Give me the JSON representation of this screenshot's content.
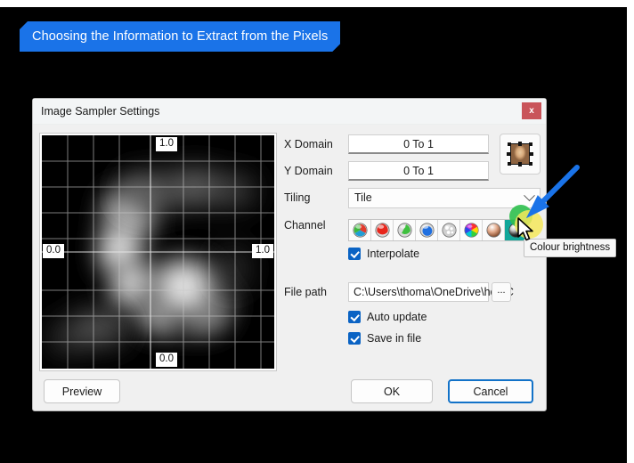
{
  "annotation": {
    "banner_text": "Choosing the Information to Extract from the Pixels",
    "banner_color": "#1a73e8",
    "arrow_color": "#1a73e8",
    "highlight_yellow": "#f5e85c",
    "highlight_green": "#2fc04e"
  },
  "dialog": {
    "title": "Image Sampler Settings",
    "close_label": "x",
    "close_color": "#c9545a"
  },
  "preview": {
    "label_top": "1.0",
    "label_left": "0.0",
    "label_right": "1.0",
    "label_bottom": "0.0"
  },
  "form": {
    "x_domain": {
      "label": "X Domain",
      "value": "0 To 1"
    },
    "y_domain": {
      "label": "Y Domain",
      "value": "0 To 1"
    },
    "tiling": {
      "label": "Tiling",
      "value": "Tile"
    },
    "channel": {
      "label": "Channel",
      "selected_index": 7,
      "selected_color": "#12a79a"
    },
    "interpolate": {
      "label": "Interpolate",
      "checked": true
    },
    "file_path": {
      "label": "File path",
      "value": "C:\\Users\\thoma\\OneDrive\\hop\\C",
      "browse_label": "..."
    },
    "auto_update": {
      "label": "Auto update",
      "checked": true
    },
    "save_in_file": {
      "label": "Save in file",
      "checked": true
    },
    "thumbnail_name": "mona-lisa-thumbnail"
  },
  "channels": [
    {
      "name": "rgb-channel-icon",
      "tooltip": "Colour RGB"
    },
    {
      "name": "red-channel-icon",
      "tooltip": "Colour red"
    },
    {
      "name": "green-channel-icon",
      "tooltip": "Colour green"
    },
    {
      "name": "blue-channel-icon",
      "tooltip": "Colour blue"
    },
    {
      "name": "alpha-channel-icon",
      "tooltip": "Colour alpha"
    },
    {
      "name": "hue-channel-icon",
      "tooltip": "Colour hue"
    },
    {
      "name": "saturation-channel-icon",
      "tooltip": "Colour saturation"
    },
    {
      "name": "brightness-channel-icon",
      "tooltip": "Colour brightness"
    }
  ],
  "tooltip": {
    "text": "Colour brightness"
  },
  "footer": {
    "preview": "Preview",
    "ok": "OK",
    "cancel": "Cancel"
  }
}
